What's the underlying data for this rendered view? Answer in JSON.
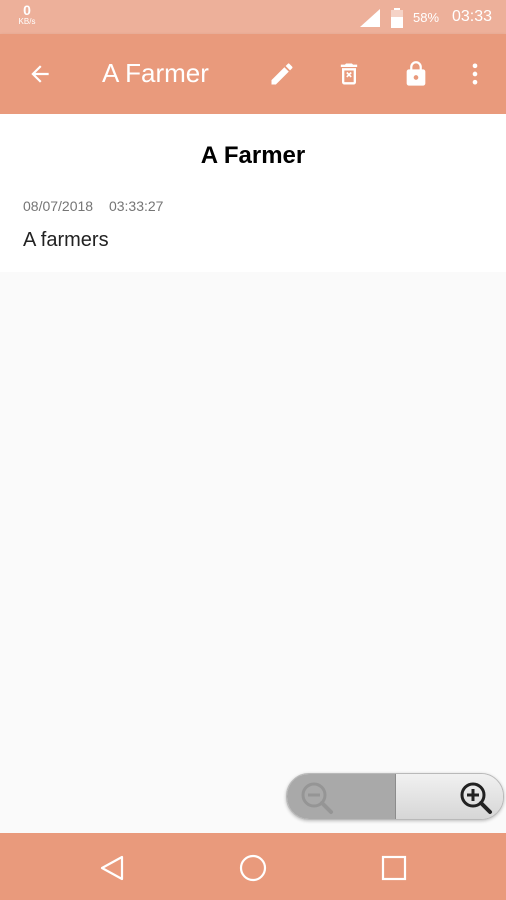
{
  "status_bar": {
    "net_speed": "0",
    "net_unit": "KB/s",
    "battery": "58%",
    "time": "03:33"
  },
  "app_bar": {
    "title": "A Farmer",
    "icons": [
      "back-arrow-icon",
      "pencil-icon",
      "trash-icon",
      "lock-icon",
      "overflow-menu-icon"
    ]
  },
  "note": {
    "title": "A Farmer",
    "date": "08/07/2018",
    "time": "03:33:27",
    "body": "A farmers"
  },
  "zoom_controls": {
    "icons": [
      "zoom-out-icon",
      "zoom-in-icon"
    ]
  },
  "nav_bar": {
    "icons": [
      "back-triangle-icon",
      "home-circle-icon",
      "recents-square-icon"
    ]
  },
  "colors": {
    "status_bar": "#edb09a",
    "app_bar": "#e99a7c",
    "nav_bar": "#e99a7c",
    "background": "#fafafa"
  }
}
